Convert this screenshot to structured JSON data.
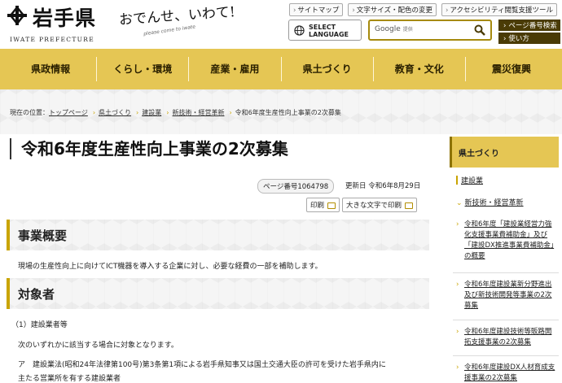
{
  "header": {
    "logo_text": "岩手県",
    "logo_sub": "IWATE PREFECTURE",
    "catchphrase": "おでんせ、いわて!",
    "catchphrase_sub": "please come to iwate",
    "top_links": [
      "サイトマップ",
      "文字サイズ・配色の変更",
      "アクセシビリティ閲覧支援ツール"
    ],
    "language_button": "SELECT LANGUAGE",
    "search_engine": "Google",
    "search_tag": "提供",
    "side_buttons": [
      "ページ番号検索",
      "使い方"
    ]
  },
  "nav": {
    "items": [
      "県政情報",
      "くらし・環境",
      "産業・雇用",
      "県土づくり",
      "教育・文化",
      "震災復興"
    ]
  },
  "breadcrumb": {
    "prefix": "現在の位置：",
    "items": [
      "トップページ",
      "県土づくり",
      "建設業",
      "新技術・経営革新",
      "令和6年度生産性向上事業の2次募集"
    ]
  },
  "main": {
    "title": "令和6年度生産性向上事業の2次募集",
    "page_number": "ページ番号1064798",
    "updated": "更新日 令和6年8月29日",
    "print_label": "印刷",
    "print_large_label": "大きな文字で印刷",
    "sections": [
      {
        "heading": "事業概要",
        "text": "現場の生産性向上に向けてICT機器を導入する企業に対し、必要な経費の一部を補助します。"
      },
      {
        "heading": "対象者",
        "lines": [
          "（1）建設業者等",
          "次のいずれかに該当する場合に対象となります。",
          "ア　建設業法(昭和24年法律第100号)第3条第1項による岩手県知事又は国土交通大臣の許可を受けた岩手県内に",
          "主たる営業所を有する建設業者"
        ]
      }
    ]
  },
  "sidebar": {
    "heading": "県土づくり",
    "level1": "建設業",
    "level2": "新技術・経営革新",
    "items": [
      "令和6年度「建設業経営力強化支援事業費補助金」及び「建設DX推進事業費補助金」の概要",
      "令和6年度建設業新分野進出及び新技術開発等事業の2次募集",
      "令和6年度建設技術等販路開拓支援事業の2次募集",
      "令和6年度建設DX人材育成支援事業の2次募集"
    ]
  },
  "colors": {
    "accent": "#e5c654",
    "accent_dark": "#c9a400",
    "dark_button": "#4a3b06"
  }
}
